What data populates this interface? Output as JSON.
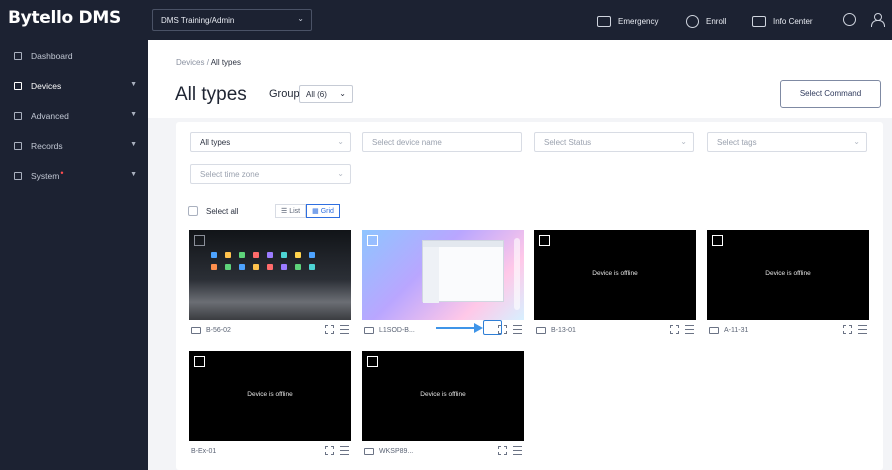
{
  "app": {
    "title": "Bytello DMS"
  },
  "topbar": {
    "tenant": "DMS Training/Admin",
    "actions": [
      {
        "label": "Emergency",
        "icon": "siren-icon"
      },
      {
        "label": "Enroll",
        "icon": "enroll-icon"
      },
      {
        "label": "Info Center",
        "icon": "message-icon"
      }
    ],
    "icons": [
      "globe-icon",
      "user-icon"
    ]
  },
  "sidebar": {
    "items": [
      {
        "label": "Dashboard",
        "icon": "chart-icon",
        "expandable": false,
        "active": false
      },
      {
        "label": "Devices",
        "icon": "monitor-icon",
        "expandable": true,
        "active": true
      },
      {
        "label": "Advanced",
        "icon": "star-icon",
        "expandable": true,
        "active": false
      },
      {
        "label": "Records",
        "icon": "records-icon",
        "expandable": true,
        "active": false
      },
      {
        "label": "System",
        "icon": "settings-icon",
        "expandable": true,
        "active": false,
        "badge_dot": "•"
      }
    ]
  },
  "main": {
    "breadcrumb": {
      "parent": "Devices",
      "separator": "/",
      "current": "All types"
    },
    "title": "All types",
    "group": {
      "label": "Group:",
      "value": "All (6)"
    },
    "select_command": "Select Command",
    "filters": {
      "type": "All types",
      "device_name_placeholder": "Select device name",
      "status_placeholder": "Select Status",
      "tags_placeholder": "Select tags",
      "timezone_placeholder": "Select time zone"
    },
    "select_all": "Select all",
    "view": {
      "list": "List",
      "grid": "Grid",
      "active": "grid"
    },
    "devices": [
      {
        "name": "B-56-02",
        "state": "online",
        "screen": "desktop-dark"
      },
      {
        "name": "L1SOD-B...",
        "state": "online",
        "screen": "desktop-light",
        "highlighted_action": "fullscreen"
      },
      {
        "name": "B-13-01",
        "state": "offline",
        "offline_text": "Device is offline"
      },
      {
        "name": "A-11-31",
        "state": "offline",
        "offline_text": "Device is offline"
      },
      {
        "name": "B-Ex-01",
        "state": "offline",
        "offline_text": "Device is offline"
      },
      {
        "name": "WKSP89...",
        "state": "offline",
        "offline_text": "Device is offline"
      }
    ]
  },
  "colors": {
    "sidebar_bg": "#1c2232",
    "accent": "#2f6fe0",
    "annotation_arrow": "#3f95e8"
  }
}
